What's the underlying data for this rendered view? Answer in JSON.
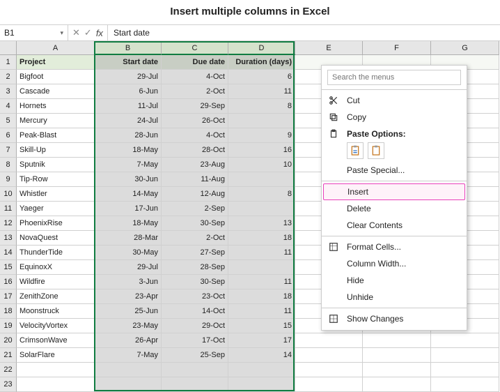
{
  "title": "Insert multiple columns in Excel",
  "nameBox": "B1",
  "formula": "Start date",
  "columns": [
    "A",
    "B",
    "C",
    "D",
    "E",
    "F",
    "G"
  ],
  "selectedCols": [
    "B",
    "C",
    "D"
  ],
  "headerRow": {
    "A": "Project",
    "B": "Start date",
    "C": "Due date",
    "D": "Duration (days)"
  },
  "rows": [
    {
      "A": "Bigfoot",
      "B": "29-Jul",
      "C": "4-Oct",
      "D": "6"
    },
    {
      "A": "Cascade",
      "B": "6-Jun",
      "C": "2-Oct",
      "D": "11"
    },
    {
      "A": "Hornets",
      "B": "11-Jul",
      "C": "29-Sep",
      "D": "8"
    },
    {
      "A": "Mercury",
      "B": "24-Jul",
      "C": "26-Oct",
      "D": ""
    },
    {
      "A": "Peak-Blast",
      "B": "28-Jun",
      "C": "4-Oct",
      "D": "9"
    },
    {
      "A": "Skill-Up",
      "B": "18-May",
      "C": "28-Oct",
      "D": "16"
    },
    {
      "A": "Sputnik",
      "B": "7-May",
      "C": "23-Aug",
      "D": "10"
    },
    {
      "A": "Tip-Row",
      "B": "30-Jun",
      "C": "11-Aug",
      "D": ""
    },
    {
      "A": "Whistler",
      "B": "14-May",
      "C": "12-Aug",
      "D": "8"
    },
    {
      "A": "Yaeger",
      "B": "17-Jun",
      "C": "2-Sep",
      "D": ""
    },
    {
      "A": "PhoenixRise",
      "B": "18-May",
      "C": "30-Sep",
      "D": "13"
    },
    {
      "A": "NovaQuest",
      "B": "28-Mar",
      "C": "2-Oct",
      "D": "18"
    },
    {
      "A": "ThunderTide",
      "B": "30-May",
      "C": "27-Sep",
      "D": "11"
    },
    {
      "A": "EquinoxX",
      "B": "29-Jul",
      "C": "28-Sep",
      "D": ""
    },
    {
      "A": "Wildfire",
      "B": "3-Jun",
      "C": "30-Sep",
      "D": "11"
    },
    {
      "A": "ZenithZone",
      "B": "23-Apr",
      "C": "23-Oct",
      "D": "18"
    },
    {
      "A": "Moonstruck",
      "B": "25-Jun",
      "C": "14-Oct",
      "D": "11"
    },
    {
      "A": "VelocityVortex",
      "B": "23-May",
      "C": "29-Oct",
      "D": "15"
    },
    {
      "A": "CrimsonWave",
      "B": "26-Apr",
      "C": "17-Oct",
      "D": "17"
    },
    {
      "A": "SolarFlare",
      "B": "7-May",
      "C": "25-Sep",
      "D": "14"
    }
  ],
  "emptyRowsAfter": 2,
  "menu": {
    "searchPlaceholder": "Search the menus",
    "cut": "Cut",
    "copy": "Copy",
    "pasteOptions": "Paste Options:",
    "pasteSpecial": "Paste Special...",
    "insert": "Insert",
    "delete": "Delete",
    "clear": "Clear Contents",
    "formatCells": "Format Cells...",
    "colWidth": "Column Width...",
    "hide": "Hide",
    "unhide": "Unhide",
    "showChanges": "Show Changes"
  }
}
